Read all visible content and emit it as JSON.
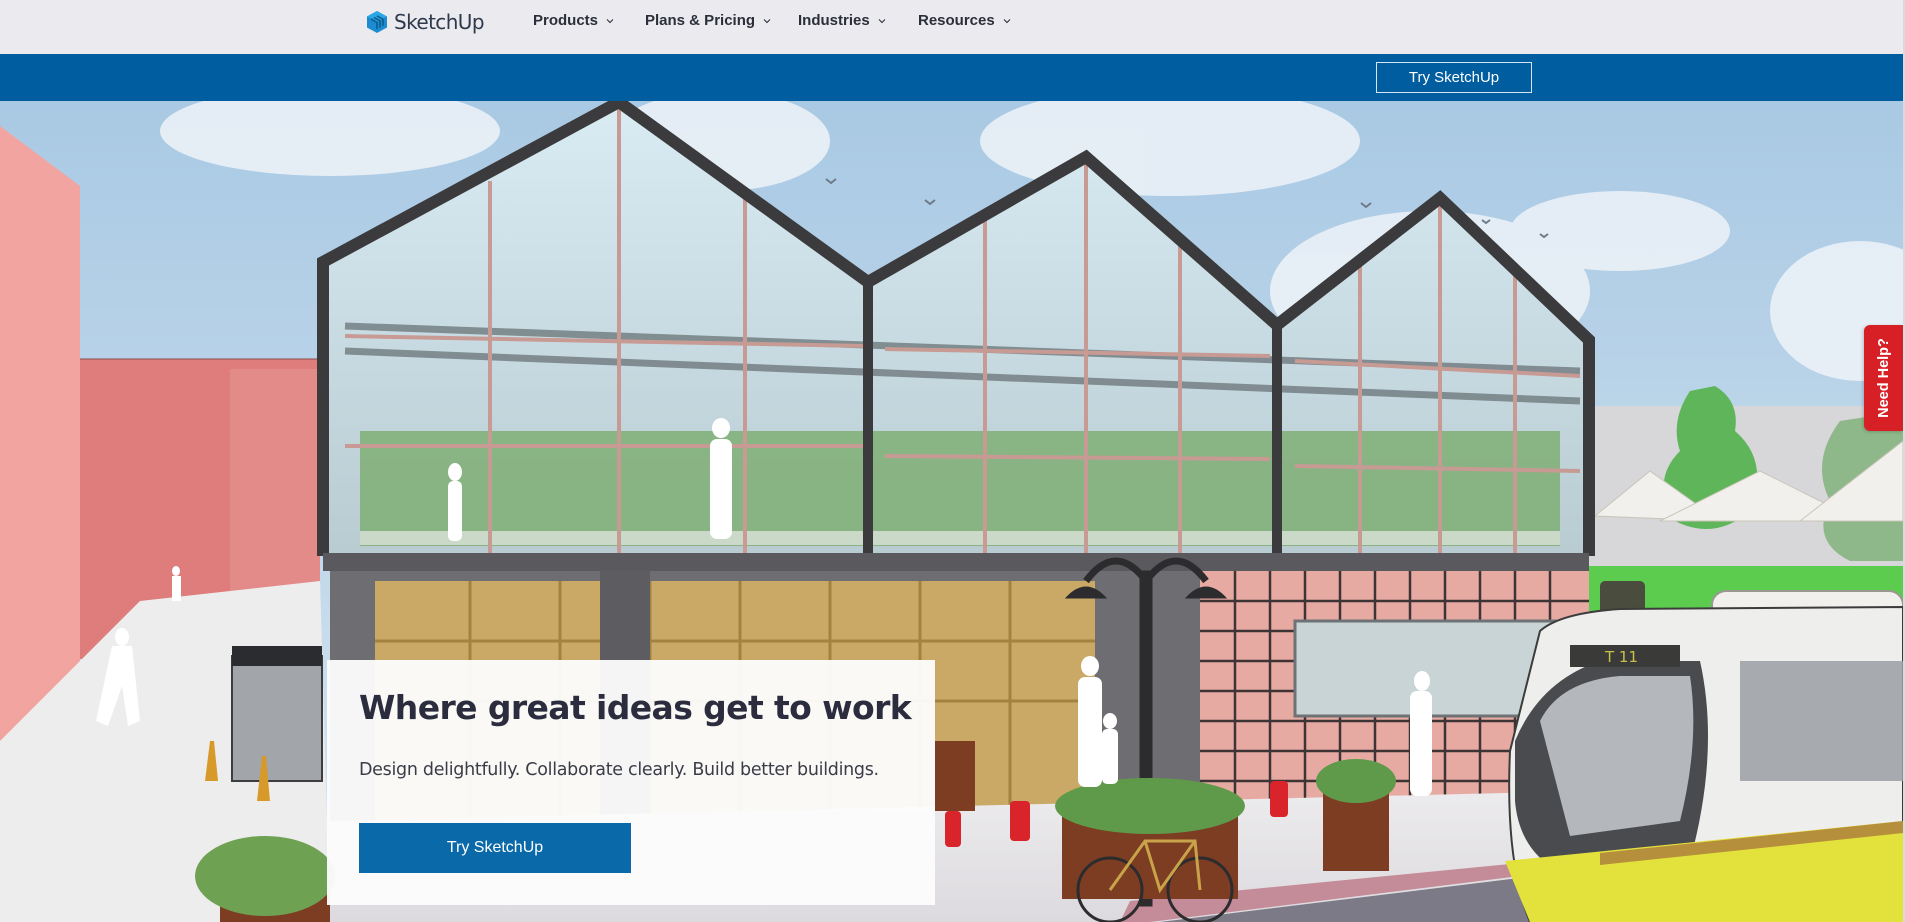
{
  "header": {
    "logo_text": "SketchUp",
    "nav": [
      {
        "label": "Products",
        "icon": "chevron-down-icon"
      },
      {
        "label": "Plans & Pricing",
        "icon": "chevron-down-icon"
      },
      {
        "label": "Industries",
        "icon": "chevron-down-icon"
      },
      {
        "label": "Resources",
        "icon": "chevron-down-icon"
      }
    ]
  },
  "subbar": {
    "cta_label": "Try SketchUp"
  },
  "hero": {
    "title": "Where great ideas get to work",
    "subtitle": "Design delightfully. Collaborate clearly. Build better buildings.",
    "cta_label": "Try SketchUp",
    "illustration": {
      "description": "Greenhouse building rendering with street scene",
      "bus_sign": "T 11"
    }
  },
  "help_tab": {
    "label": "Need Help?"
  },
  "colors": {
    "header_bg": "#ebeaef",
    "brand_blue": "#005da0",
    "button_blue": "#0a69a9",
    "help_red": "#d71f26",
    "title_text": "#2b2d3f"
  }
}
